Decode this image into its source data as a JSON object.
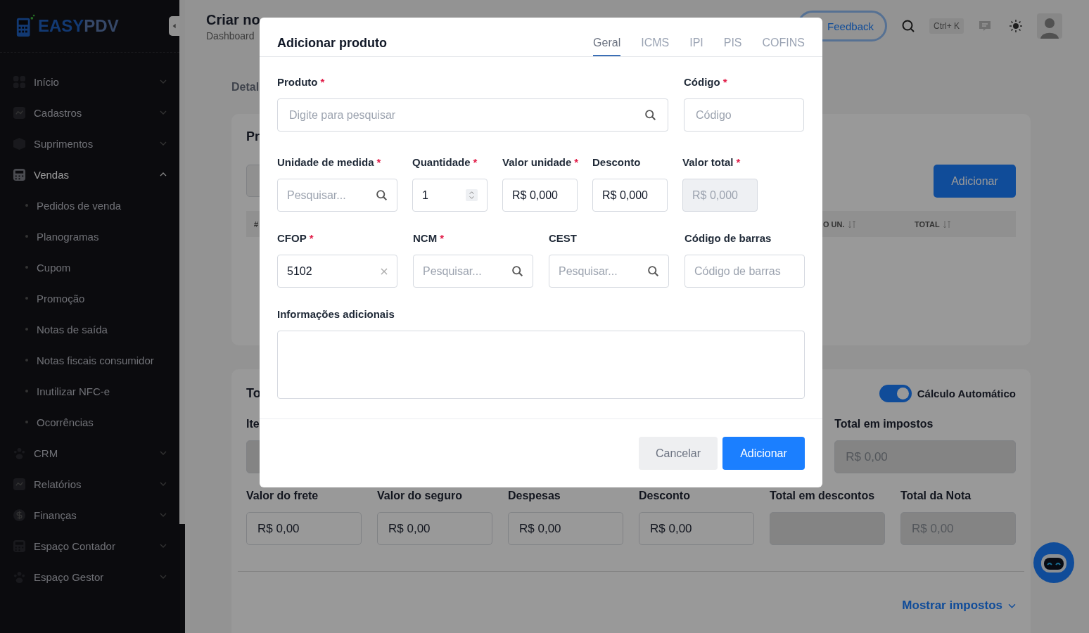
{
  "sidebar": {
    "logo": {
      "part_1": "EASY",
      "part_2": "PDV"
    },
    "items": [
      {
        "label": "Início",
        "expanded": false
      },
      {
        "label": "Cadastros",
        "expanded": false
      },
      {
        "label": "Suprimentos",
        "expanded": false
      },
      {
        "label": "Vendas",
        "expanded": true,
        "children": [
          {
            "label": "Pedidos de venda"
          },
          {
            "label": "Planogramas"
          },
          {
            "label": "Cupom"
          },
          {
            "label": "Promoção"
          },
          {
            "label": "Notas de saída"
          },
          {
            "label": "Notas fiscais consumidor"
          },
          {
            "label": "Inutilizar NFC-e"
          },
          {
            "label": "Ocorrências"
          }
        ]
      },
      {
        "label": "CRM",
        "expanded": false
      },
      {
        "label": "Relatórios",
        "expanded": false
      },
      {
        "label": "Finanças",
        "expanded": false
      },
      {
        "label": "Espaço Contador",
        "expanded": false
      },
      {
        "label": "Espaço Gestor",
        "expanded": false
      }
    ]
  },
  "header": {
    "title": "Criar no",
    "breadcrumb": "Dashboard",
    "feedback_button": "Feedback",
    "shortcut": "Ctrl+ K"
  },
  "page": {
    "section_label": "Detal",
    "products_card": {
      "title": "Pr",
      "add_button": "Adicionar",
      "columns": [
        "#",
        "O UN.",
        "TOTAL"
      ]
    },
    "totals_card": {
      "title": "To",
      "auto_calc": {
        "label": "Cálculo Automático",
        "on": true
      },
      "top_fields": [
        {
          "label": "Ite",
          "disabled": true
        },
        {
          "label": "Total em impostos",
          "value": "R$ 0,00",
          "disabled": true
        }
      ],
      "fields": [
        {
          "label": "Valor do frete",
          "value": "R$ 0,00",
          "disabled": false
        },
        {
          "label": "Valor do seguro",
          "value": "R$ 0,00",
          "disabled": false
        },
        {
          "label": "Despesas",
          "value": "R$ 0,00",
          "disabled": false
        },
        {
          "label": "Desconto",
          "value": "R$ 0,00",
          "disabled": false
        },
        {
          "label": "Total em descontos",
          "disabled": true
        },
        {
          "label": "Total da Nota",
          "value": "R$ 0,00",
          "disabled": true
        }
      ],
      "link": "Mostrar impostos"
    }
  },
  "modal": {
    "title": "Adicionar produto",
    "tabs": [
      {
        "label": "Geral",
        "selected": true
      },
      {
        "label": "ICMS",
        "selected": false
      },
      {
        "label": "IPI",
        "selected": false
      },
      {
        "label": "PIS",
        "selected": false
      },
      {
        "label": "COFINS",
        "selected": false
      }
    ],
    "product_fields": [
      {
        "label": "Produto",
        "mark": "*",
        "kind": "search",
        "placeholder": "Digite para pesquisar"
      },
      {
        "label": "Código",
        "mark": "*",
        "kind": "text",
        "placeholder": "Código"
      }
    ],
    "pricing_fields": [
      {
        "label": "Unidade de medida",
        "mark": "*",
        "kind": "search",
        "placeholder": "Pesquisar..."
      },
      {
        "label": "Quantidade",
        "mark": "*",
        "kind": "number",
        "value": "1"
      },
      {
        "label": "Valor unidade",
        "mark": "*",
        "kind": "text",
        "value": "R$ 0,000"
      },
      {
        "label": "Desconto",
        "kind": "text",
        "value": "R$ 0,000"
      },
      {
        "label": "Valor total",
        "mark": "*",
        "kind": "disabled",
        "value": "R$ 0,000"
      }
    ],
    "tax_fields": [
      {
        "label": "CFOP",
        "mark": "*",
        "kind": "clear",
        "value": "5102"
      },
      {
        "label": "NCM",
        "mark": "*",
        "kind": "search",
        "placeholder": "Pesquisar..."
      },
      {
        "label": "CEST",
        "kind": "search",
        "placeholder": "Pesquisar..."
      },
      {
        "label": "Código de barras",
        "kind": "text",
        "placeholder": "Código de barras"
      }
    ],
    "notes": {
      "label": "Informações adicionais"
    },
    "cancel_button": "Cancelar",
    "confirm_button": "Adicionar"
  }
}
